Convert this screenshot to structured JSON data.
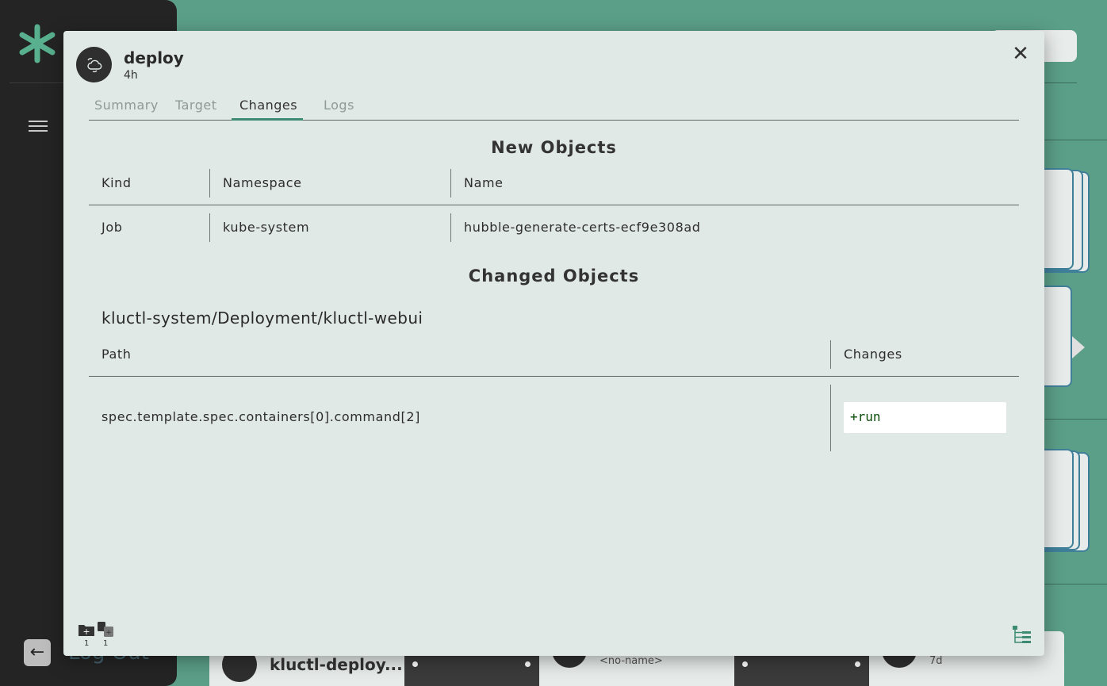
{
  "background": {
    "logout_label": "Log Out",
    "bottom_card_name": "kluctl-deploy...",
    "bottom_no_name": "<no-name>",
    "bottom_age": "7d"
  },
  "modal": {
    "title": "deploy",
    "subtitle": "4h",
    "tabs": [
      {
        "label": "Summary"
      },
      {
        "label": "Target"
      },
      {
        "label": "Changes"
      },
      {
        "label": "Logs"
      }
    ],
    "active_tab": "Changes",
    "new_objects": {
      "title": "New Objects",
      "columns": [
        "Kind",
        "Namespace",
        "Name"
      ],
      "rows": [
        {
          "kind": "Job",
          "namespace": "kube-system",
          "name": "hubble-generate-certs-ecf9e308ad"
        }
      ]
    },
    "changed_objects": {
      "title": "Changed Objects",
      "object_ref": "kluctl-system/Deployment/kluctl-webui",
      "columns": [
        "Path",
        "Changes"
      ],
      "rows": [
        {
          "path": "spec.template.spec.containers[0].command[2]",
          "change": "+run"
        }
      ]
    },
    "footer": {
      "new_count": "1",
      "changed_count": "1"
    }
  },
  "colors": {
    "accent": "#3e8b74",
    "background": "#5b9f88",
    "sidebar": "#242424",
    "modal": "#e1e9e6",
    "diff_added": "#0a4d0a"
  }
}
